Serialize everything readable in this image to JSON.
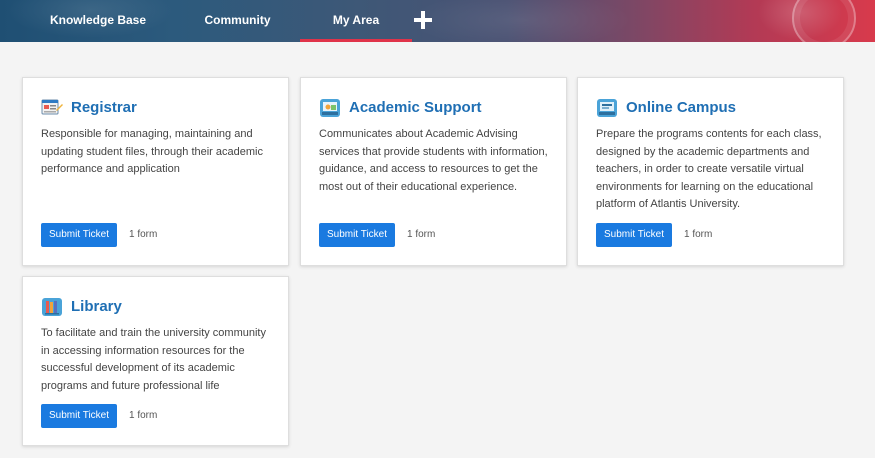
{
  "nav": {
    "items": [
      {
        "label": "Knowledge Base"
      },
      {
        "label": "Community"
      },
      {
        "label": "My Area"
      }
    ],
    "add_icon": "plus-icon",
    "active_color": "#e0334a"
  },
  "cards": [
    {
      "title": "Registrar",
      "icon": "registrar-icon",
      "description": "Responsible for managing, maintaining and updating student files, through their academic performance and application",
      "button": "Submit Ticket",
      "forms": "1 form"
    },
    {
      "title": "Academic Support",
      "icon": "academic-support-icon",
      "description": "Communicates about Academic Advising services that provide students with information, guidance, and access to resources to get the most out of their educational experience.",
      "button": "Submit Ticket",
      "forms": "1 form"
    },
    {
      "title": "Online Campus",
      "icon": "online-campus-icon",
      "description": "Prepare the programs contents for each class, designed by the academic departments and teachers, in order to create versatile virtual environments for learning on the educational platform of Atlantis University.",
      "button": "Submit Ticket",
      "forms": "1 form"
    },
    {
      "title": "Library",
      "icon": "library-icon",
      "description": "To facilitate and train the university community in accessing information resources for the successful development of its academic programs and future professional life",
      "button": "Submit Ticket",
      "forms": "1 form"
    }
  ],
  "colors": {
    "accent": "#1a7ae0",
    "title": "#1f6fb4"
  }
}
